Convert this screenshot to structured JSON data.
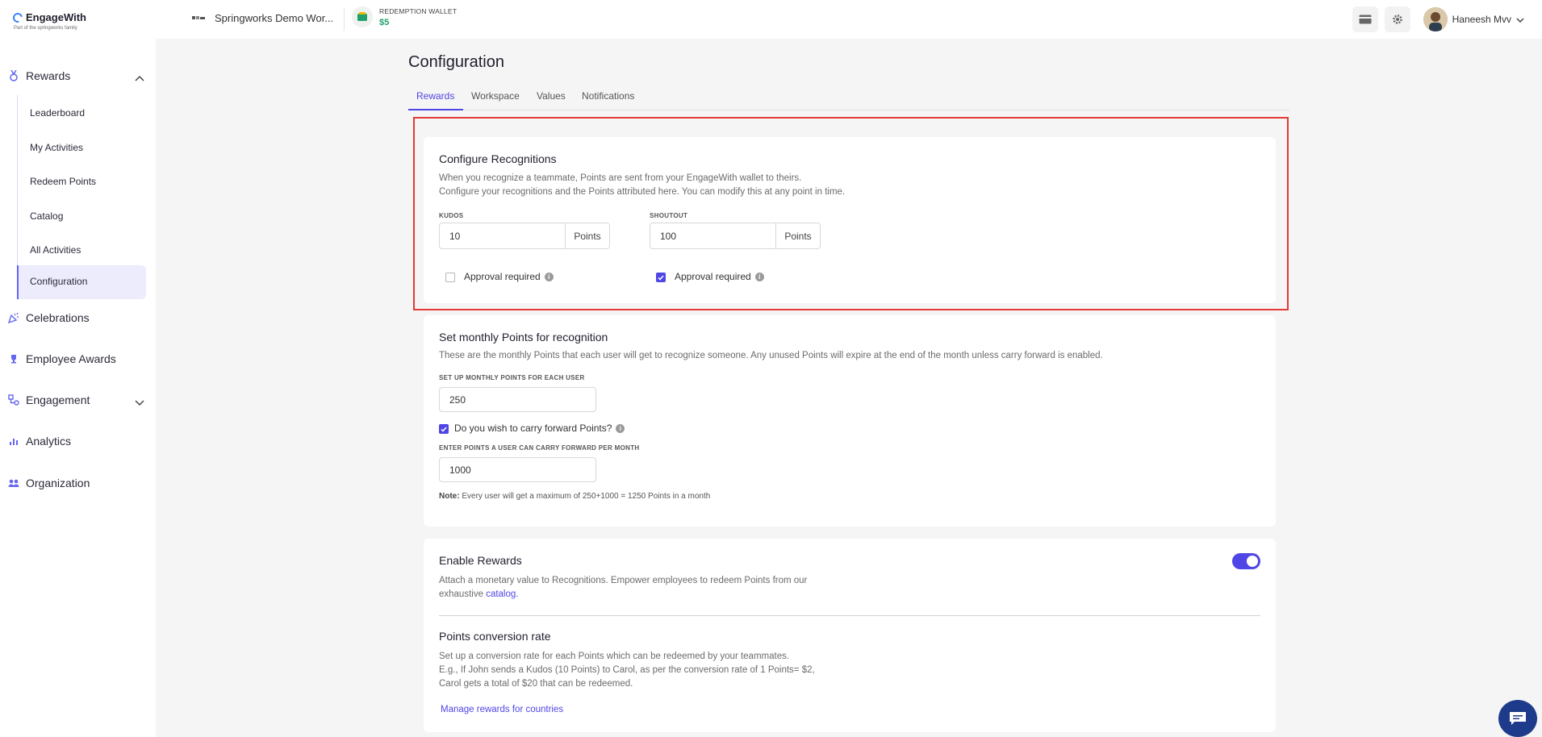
{
  "header": {
    "logo_text": "EngageWith",
    "logo_sub": "Part of the springworks family",
    "workspace_name": "Springworks Demo Wor...",
    "wallet_label": "REDEMPTION WALLET",
    "wallet_amount": "$5",
    "user_name": "Haneesh Mvv"
  },
  "sidebar": {
    "rewards": "Rewards",
    "sub_items": [
      "Leaderboard",
      "My Activities",
      "Redeem Points",
      "Catalog",
      "All Activities",
      "Configuration"
    ],
    "celebrations": "Celebrations",
    "employee_awards": "Employee Awards",
    "engagement": "Engagement",
    "analytics": "Analytics",
    "organization": "Organization"
  },
  "page": {
    "title": "Configuration",
    "tabs": [
      "Rewards",
      "Workspace",
      "Values",
      "Notifications"
    ]
  },
  "recognitions": {
    "title": "Configure Recognitions",
    "desc1": "When you recognize a teammate, Points are sent from your EngageWith wallet to theirs.",
    "desc2": "Configure your recognitions and the Points attributed here. You can modify this at any point in time.",
    "kudos_label": "KUDOS",
    "kudos_value": "10",
    "shoutout_label": "SHOUTOUT",
    "shoutout_value": "100",
    "points_suffix": "Points",
    "approval_label": "Approval required",
    "kudos_approval": false,
    "shoutout_approval": true
  },
  "monthly": {
    "title": "Set monthly Points for recognition",
    "desc": "These are the monthly Points that each user will get to recognize someone. Any unused Points will expire at the end of the month unless carry forward is enabled.",
    "setup_label": "SET UP MONTHLY POINTS FOR EACH USER",
    "setup_value": "250",
    "carry_label": "Do you wish to carry forward Points?",
    "carry_enabled": true,
    "carry_field_label": "ENTER POINTS A USER CAN CARRY FORWARD PER MONTH",
    "carry_value": "1000",
    "note_label": "Note:",
    "note_text": "Every user will get a maximum of 250+1000 = 1250 Points in a month"
  },
  "rewards_card": {
    "title": "Enable Rewards",
    "desc1": "Attach a monetary value to Recognitions. Empower employees to redeem Points from our",
    "desc2_prefix": "exhaustive",
    "desc2_link": "catalog.",
    "enabled": true,
    "conversion_title": "Points conversion rate",
    "conv1": "Set up a conversion rate for each Points which can be redeemed by your teammates.",
    "conv2": "E.g., If John sends a Kudos (10 Points) to Carol, as per the conversion rate of 1 Points= $2,",
    "conv3": "Carol gets a total of $20 that can be redeemed.",
    "manage_link": "Manage rewards for countries"
  },
  "colors": {
    "accent": "#4f46e5",
    "highlight": "#e53935",
    "wallet_green": "#22a06b"
  }
}
